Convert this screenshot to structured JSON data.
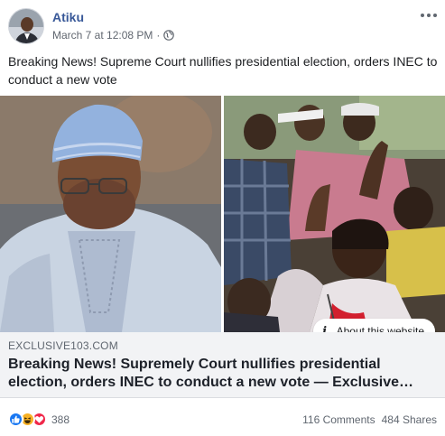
{
  "post": {
    "author": "Atiku",
    "timestamp": "March 7 at 12:08 PM",
    "separator": "·",
    "privacy_icon": "globe-icon",
    "text": "Breaking News! Supreme Court nullifies presidential election, orders INEC to conduct a new vote"
  },
  "media": {
    "about_label": "About this website"
  },
  "link": {
    "domain": "EXCLUSIVE103.COM",
    "title": "Breaking News! Supremely Court nullifies presidential election, orders INEC to conduct a new vote — Exclusive…"
  },
  "footer": {
    "reaction_icons": [
      "like-icon",
      "haha-icon",
      "love-icon"
    ],
    "reaction_count": "388",
    "comments": "116 Comments",
    "shares": "484 Shares"
  },
  "colors": {
    "author_link": "#385898",
    "meta_text": "#616770",
    "link_box_bg": "#f2f3f5",
    "like_blue": "#1877f2",
    "haha_yellow": "#f7b125",
    "love_red": "#f0284a"
  }
}
